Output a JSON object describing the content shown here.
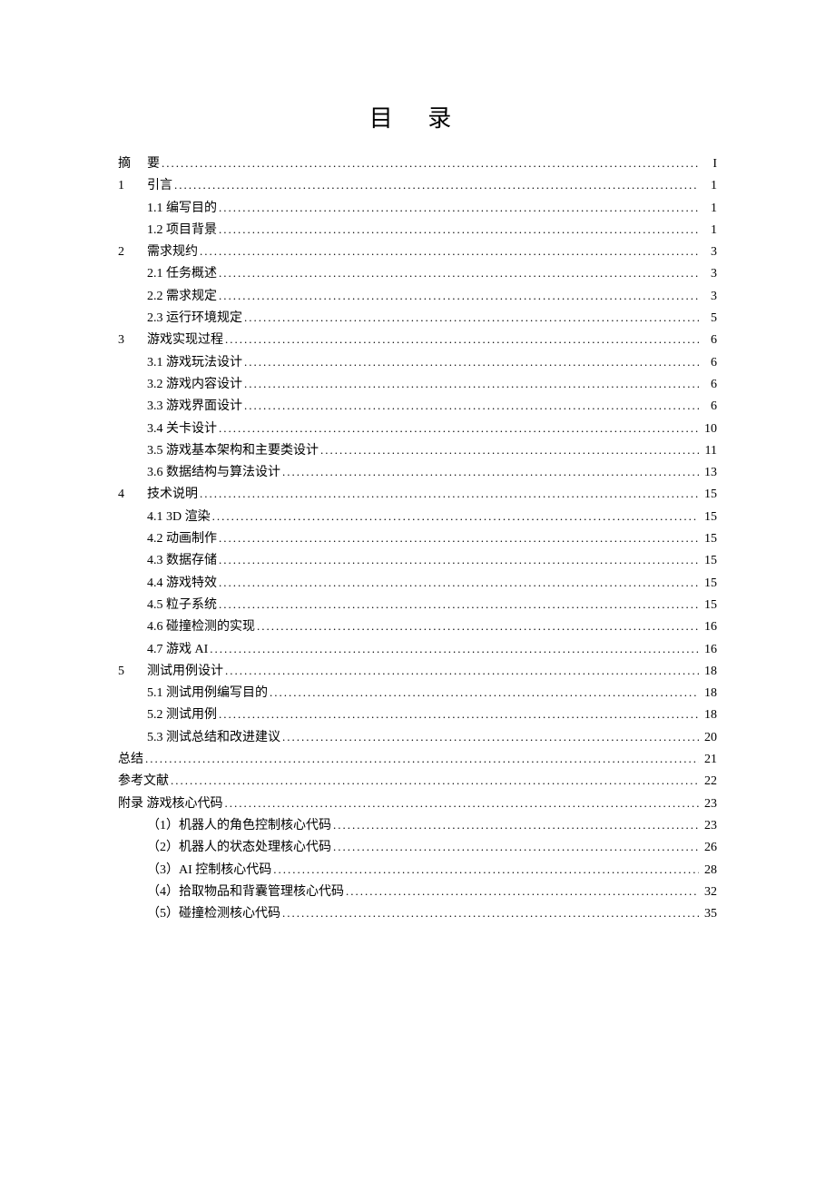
{
  "title": "目 录",
  "toc": [
    {
      "num": "摘",
      "label": "要",
      "page": "I",
      "level": 0,
      "hasNumCol": true
    },
    {
      "num": "1",
      "label": "引言",
      "page": "1",
      "level": 0,
      "hasNumCol": true
    },
    {
      "num": "",
      "label": "1.1 编写目的",
      "page": "1",
      "level": 1,
      "hasNumCol": false
    },
    {
      "num": "",
      "label": "1.2 项目背景",
      "page": "1",
      "level": 1,
      "hasNumCol": false
    },
    {
      "num": "2",
      "label": "需求规约",
      "page": "3",
      "level": 0,
      "hasNumCol": true
    },
    {
      "num": "",
      "label": "2.1 任务概述",
      "page": "3",
      "level": 1,
      "hasNumCol": false
    },
    {
      "num": "",
      "label": "2.2 需求规定",
      "page": "3",
      "level": 1,
      "hasNumCol": false
    },
    {
      "num": "",
      "label": "2.3 运行环境规定",
      "page": "5",
      "level": 1,
      "hasNumCol": false
    },
    {
      "num": "3",
      "label": "游戏实现过程",
      "page": "6",
      "level": 0,
      "hasNumCol": true
    },
    {
      "num": "",
      "label": "3.1 游戏玩法设计",
      "page": "6",
      "level": 1,
      "hasNumCol": false
    },
    {
      "num": "",
      "label": "3.2 游戏内容设计",
      "page": "6",
      "level": 1,
      "hasNumCol": false
    },
    {
      "num": "",
      "label": "3.3 游戏界面设计",
      "page": "6",
      "level": 1,
      "hasNumCol": false
    },
    {
      "num": "",
      "label": "3.4 关卡设计",
      "page": "10",
      "level": 1,
      "hasNumCol": false
    },
    {
      "num": "",
      "label": "3.5 游戏基本架构和主要类设计",
      "page": "11",
      "level": 1,
      "hasNumCol": false
    },
    {
      "num": "",
      "label": "3.6 数据结构与算法设计",
      "page": "13",
      "level": 1,
      "hasNumCol": false
    },
    {
      "num": "4",
      "label": "技术说明",
      "page": "15",
      "level": 0,
      "hasNumCol": true
    },
    {
      "num": "",
      "label": "4.1 3D 渲染",
      "page": "15",
      "level": 1,
      "hasNumCol": false
    },
    {
      "num": "",
      "label": "4.2 动画制作",
      "page": "15",
      "level": 1,
      "hasNumCol": false
    },
    {
      "num": "",
      "label": "4.3 数据存储",
      "page": "15",
      "level": 1,
      "hasNumCol": false
    },
    {
      "num": "",
      "label": "4.4 游戏特效",
      "page": "15",
      "level": 1,
      "hasNumCol": false
    },
    {
      "num": "",
      "label": "4.5 粒子系统",
      "page": "15",
      "level": 1,
      "hasNumCol": false
    },
    {
      "num": "",
      "label": "4.6 碰撞检测的实现",
      "page": "16",
      "level": 1,
      "hasNumCol": false
    },
    {
      "num": "",
      "label": "4.7 游戏 AI",
      "page": "16",
      "level": 1,
      "hasNumCol": false
    },
    {
      "num": "5",
      "label": "测试用例设计",
      "page": "18",
      "level": 0,
      "hasNumCol": true
    },
    {
      "num": "",
      "label": "5.1 测试用例编写目的",
      "page": "18",
      "level": 1,
      "hasNumCol": false
    },
    {
      "num": "",
      "label": "5.2 测试用例",
      "page": "18",
      "level": 1,
      "hasNumCol": false
    },
    {
      "num": "",
      "label": "5.3 测试总结和改进建议",
      "page": "20",
      "level": 1,
      "hasNumCol": false
    },
    {
      "num": "",
      "label": "总结",
      "page": "21",
      "level": 0,
      "hasNumCol": false
    },
    {
      "num": "",
      "label": "参考文献",
      "page": "22",
      "level": 0,
      "hasNumCol": false
    },
    {
      "num": "",
      "label": "附录 游戏核心代码",
      "page": "23",
      "level": 0,
      "hasNumCol": false
    },
    {
      "num": "",
      "label": "（1）机器人的角色控制核心代码",
      "page": "23",
      "level": 1,
      "hasNumCol": false
    },
    {
      "num": "",
      "label": "（2）机器人的状态处理核心代码",
      "page": "26",
      "level": 1,
      "hasNumCol": false
    },
    {
      "num": "",
      "label": "（3）AI 控制核心代码",
      "page": "28",
      "level": 1,
      "hasNumCol": false
    },
    {
      "num": "",
      "label": "（4）拾取物品和背囊管理核心代码",
      "page": "32",
      "level": 1,
      "hasNumCol": false
    },
    {
      "num": "",
      "label": "（5）碰撞检测核心代码",
      "page": "35",
      "level": 1,
      "hasNumCol": false
    }
  ]
}
